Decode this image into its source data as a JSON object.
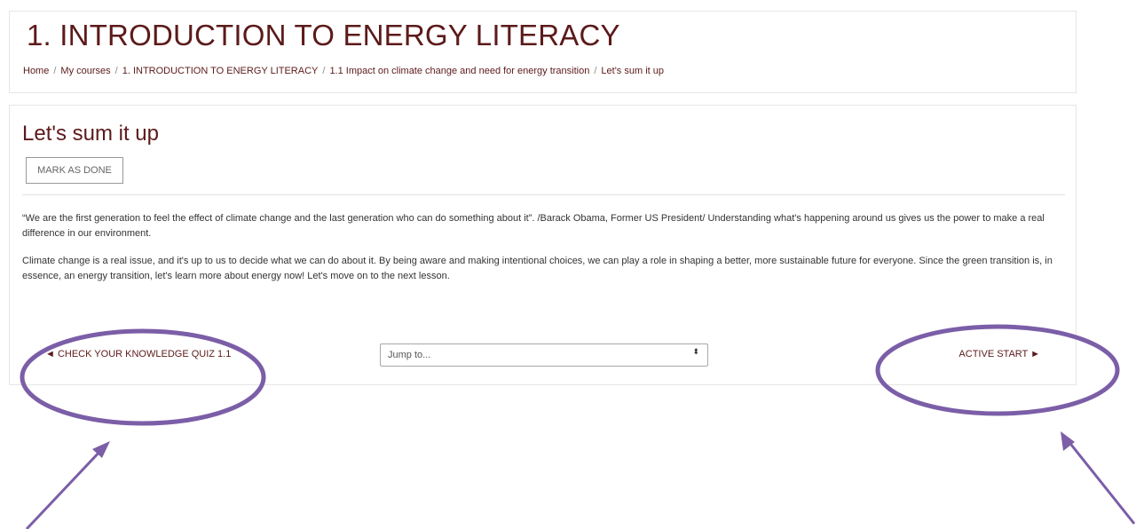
{
  "header": {
    "title": "1. INTRODUCTION TO ENERGY LITERACY",
    "breadcrumb": [
      "Home",
      "My courses",
      "1. INTRODUCTION TO ENERGY LITERACY",
      "1.1 Impact on climate change and need for energy transition",
      "Let's sum it up"
    ],
    "breadcrumb_separator": "/"
  },
  "activity": {
    "title": "Let's sum it up",
    "mark_done_label": "MARK AS DONE",
    "paragraphs": [
      "“We are the first generation to feel the effect of climate change and the last generation who can do something about it”. /Barack Obama, Former US President/ Understanding what's happening around us gives us the power to make a real difference in our environment.",
      "Climate change is a real issue, and it's up to us to decide what we can do about it. By being aware and making intentional choices, we can play a role in shaping a better, more sustainable future for everyone. Since the green transition is, in essence, an energy transition, let's learn more about energy now! Let's move on to the next lesson."
    ]
  },
  "navigation": {
    "prev_label": "◄ CHECK YOUR KNOWLEDGE  QUIZ 1.1",
    "next_label": "ACTIVE START ►",
    "jump_placeholder": "Jump to...",
    "jump_arrows": "⬍"
  },
  "colors": {
    "brand": "#5c1a1a",
    "annotation": "#7b5ea7"
  }
}
